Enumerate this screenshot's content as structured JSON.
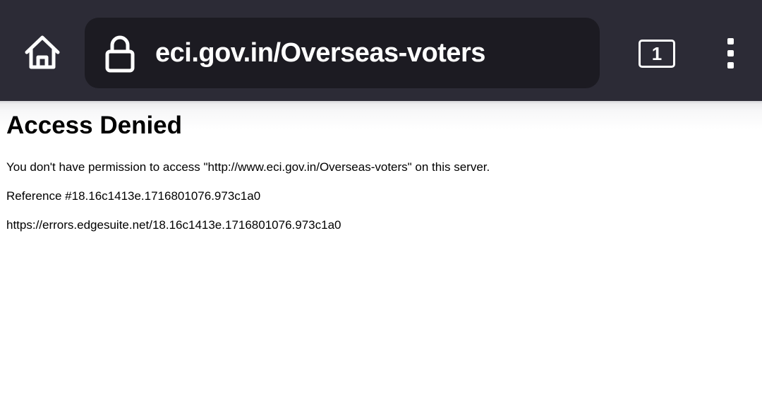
{
  "browser": {
    "url": "eci.gov.in/Overseas-voters",
    "tab_count": "1",
    "toolbar_color": "#2c2b36",
    "urlbar_color": "#1c1b22",
    "icons": {
      "home": "home-icon",
      "lock": "lock-icon",
      "tabs": "tabs-icon",
      "menu": "more-vert-icon"
    }
  },
  "page": {
    "title": "Access Denied",
    "message": "You don't have permission to access \"http://www.eci.gov.in/Overseas-voters\" on this server.",
    "reference": "Reference #18.16c1413e.1716801076.973c1a0",
    "error_link": "https://errors.edgesuite.net/18.16c1413e.1716801076.973c1a0"
  }
}
